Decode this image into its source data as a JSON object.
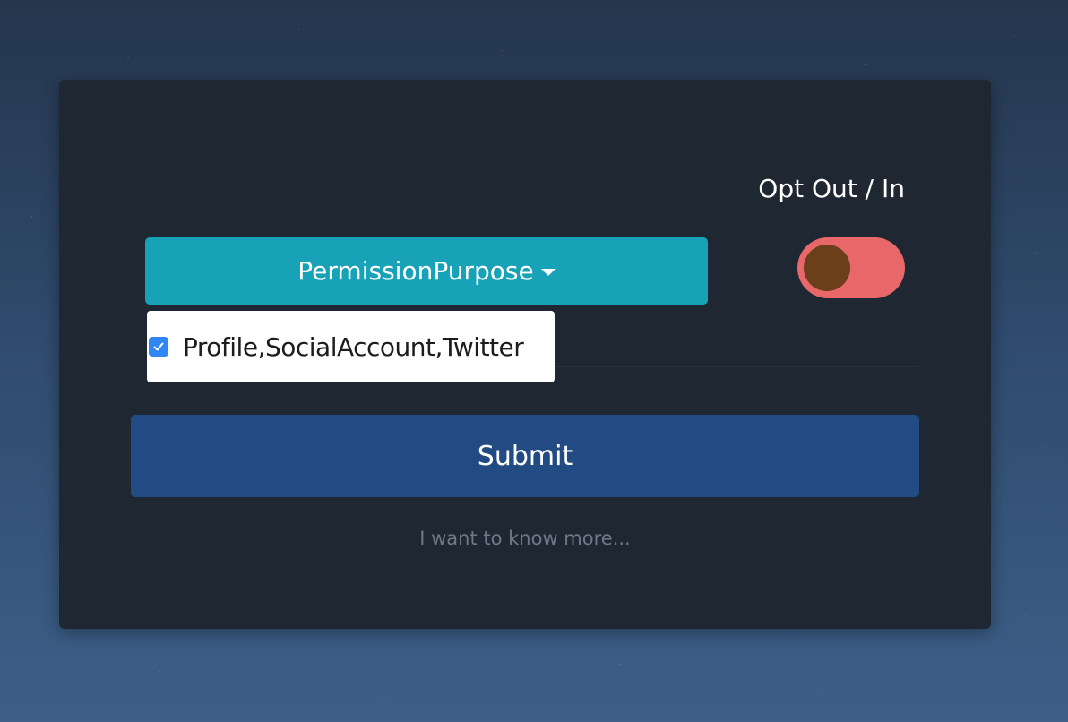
{
  "form": {
    "opt_label": "Opt Out / In",
    "dropdown_label": "PermissionPurpose",
    "dropdown_item_label": "Profile,SocialAccount,Twitter",
    "dropdown_item_checked": true,
    "toggle_state": "off",
    "submit_label": "Submit",
    "more_link": "I want to know more..."
  },
  "colors": {
    "card_bg": "#1f2732",
    "dropdown_bg": "#17a2b8",
    "toggle_track": "#e8686a",
    "toggle_knob": "#6b3f1a",
    "submit_bg": "#214b82",
    "checkbox": "#2f86f6",
    "link_text": "#6f7884"
  },
  "icons": {
    "caret": "chevron-down-icon",
    "check": "checkmark-icon"
  }
}
